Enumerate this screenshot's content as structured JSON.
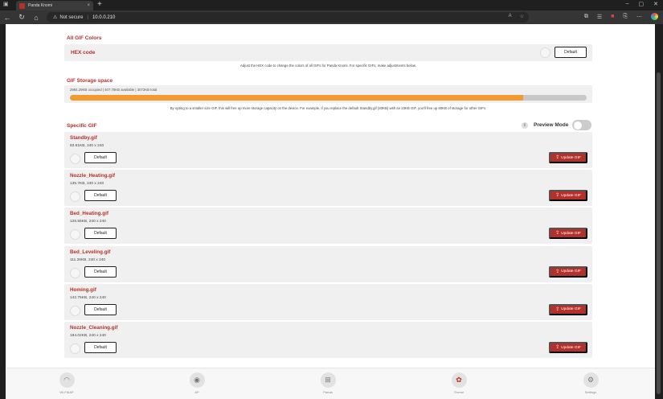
{
  "browser": {
    "tab_title": "Panda Knomi",
    "tab_close": "×",
    "new_tab": "+",
    "security_label": "Not secure",
    "url": "10.0.0.210"
  },
  "colors": {
    "accent": "#b5302b",
    "progress": "#f39b32"
  },
  "gif_colors": {
    "section_title": "All GIF Colors",
    "hex_label": "HEX code",
    "default_label": "Default",
    "help_text": "Adjust the HEX code to change the colors of all GIFs for Panda Knomi. For specific GIFs, make adjustments below."
  },
  "storage": {
    "section_title": "GIF Storage space",
    "info_text": "2984.29KB occupied | 407.75KB available | 3072KB total",
    "used_fraction": 0.877,
    "help_text": "By opting to a smaller size GIF, this will free up more storage capacity on the device. For example, if you replace the default Standby.gif (83KB) with an 23KB GIF, you'll free up 60KB of storage for other GIFs."
  },
  "specific": {
    "section_title": "Specific GIF",
    "info_icon": "i",
    "preview_label": "Preview Mode",
    "preview_on": false,
    "default_label": "Default",
    "update_label": "Update GIF",
    "update_icon": "⇪",
    "gifs": [
      {
        "name": "Standby.gif",
        "meta": "83.61KB, 240 x 240"
      },
      {
        "name": "Nozzle_Heating.gif",
        "meta": "135.7KB, 240 x 240"
      },
      {
        "name": "Bed_Heating.gif",
        "meta": "125.55KB, 240 x 240"
      },
      {
        "name": "Bed_Leveling.gif",
        "meta": "111.26KB, 240 x 240"
      },
      {
        "name": "Homing.gif",
        "meta": "142.75KB, 240 x 240"
      },
      {
        "name": "Nozzle_Cleaning.gif",
        "meta": "184.02KB, 240 x 240"
      }
    ]
  },
  "bottom_nav": [
    {
      "label": "Wi-Fi&AP",
      "icon": "wifi-icon",
      "glyph": "◠"
    },
    {
      "label": "AP",
      "icon": "antenna-icon",
      "glyph": "◉"
    },
    {
      "label": "Panda",
      "icon": "network-icon",
      "glyph": "⊞"
    },
    {
      "label": "Theme",
      "icon": "palette-icon",
      "glyph": "✿"
    },
    {
      "label": "Settings",
      "icon": "gear-icon",
      "glyph": "⚙"
    }
  ]
}
